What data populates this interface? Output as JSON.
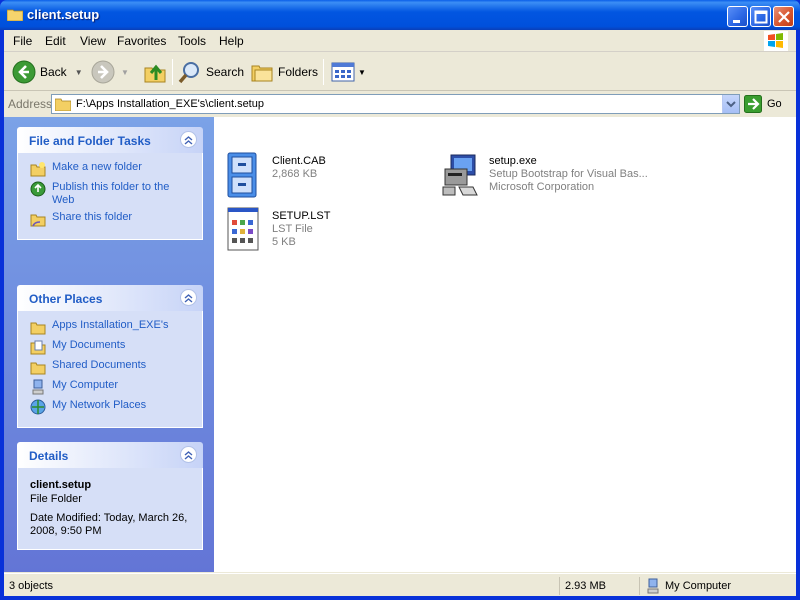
{
  "window": {
    "title": "client.setup"
  },
  "menu": [
    "File",
    "Edit",
    "View",
    "Favorites",
    "Tools",
    "Help"
  ],
  "toolbar": {
    "back": "Back",
    "search": "Search",
    "folders": "Folders"
  },
  "address": {
    "label": "Address",
    "path": "F:\\Apps Installation_EXE's\\client.setup",
    "go": "Go"
  },
  "tasks": {
    "title": "File and Folder Tasks",
    "items": [
      "Make a new folder",
      "Publish this folder to the Web",
      "Share this folder"
    ]
  },
  "places": {
    "title": "Other Places",
    "items": [
      "Apps Installation_EXE's",
      "My Documents",
      "Shared Documents",
      "My Computer",
      "My Network Places"
    ]
  },
  "details": {
    "title": "Details",
    "name": "client.setup",
    "type": "File Folder",
    "modified": "Date Modified: Today, March 26, 2008, 9:50 PM"
  },
  "files": [
    {
      "name": "Client.CAB",
      "line2": "2,868 KB",
      "line3": ""
    },
    {
      "name": "setup.exe",
      "line2": "Setup Bootstrap for Visual Bas...",
      "line3": "Microsoft Corporation"
    },
    {
      "name": "SETUP.LST",
      "line2": "LST File",
      "line3": "5 KB"
    }
  ],
  "status": {
    "objects": "3 objects",
    "size": "2.93 MB",
    "zone": "My Computer"
  }
}
